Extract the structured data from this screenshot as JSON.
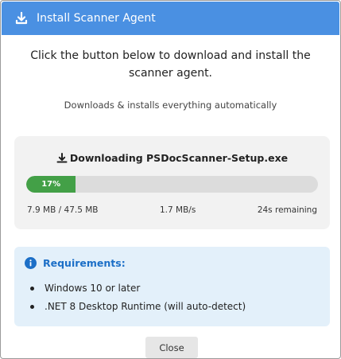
{
  "dialog": {
    "title": "Install Scanner Agent",
    "intro": "Click the button below to download and install the scanner agent.",
    "subtext": "Downloads & installs everything automatically"
  },
  "download": {
    "title": "Downloading PSDocScanner-Setup.exe",
    "progress_percent": 17,
    "progress_label": "17%",
    "size": "7.9 MB / 47.5 MB",
    "speed": "1.7 MB/s",
    "remaining": "24s remaining"
  },
  "requirements": {
    "heading": "Requirements:",
    "items": [
      "Windows 10 or later",
      ".NET 8 Desktop Runtime (will auto-detect)"
    ]
  },
  "buttons": {
    "close": "Close"
  },
  "colors": {
    "title_bar": "#4a90e2",
    "progress_fill": "#43a047",
    "info_accent": "#1c6fc7",
    "info_background": "#e3f0fa"
  },
  "icons": {
    "title": "download-icon",
    "download": "download-icon",
    "requirements": "info-icon"
  }
}
